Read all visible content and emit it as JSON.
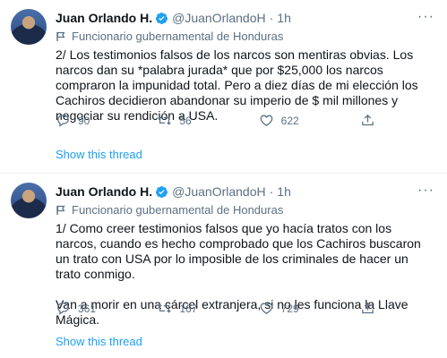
{
  "tweets": [
    {
      "name": "Juan Orlando H.",
      "handle": "@JuanOrlandoH",
      "dot": "·",
      "time": "1h",
      "label": "Funcionario gubernamental de Honduras",
      "paragraphs": [
        "2/ Los testimonios falsos de los narcos son mentiras obvias. Los narcos dan su *palabra jurada* que por $25,000 los narcos compraron la impunidad total. Pero a diez días de mi elección los Cachiros decidieron abandonar su imperio de $ mil millones y negociar su rendición a USA."
      ],
      "replies": "90",
      "retweets": "56",
      "likes": "622",
      "show_thread": "Show this thread"
    },
    {
      "name": "Juan Orlando H.",
      "handle": "@JuanOrlandoH",
      "dot": "·",
      "time": "1h",
      "label": "Funcionario gubernamental de Honduras",
      "paragraphs": [
        "1/ Como creer testimonios falsos que yo hacía tratos con los narcos, cuando es hecho comprobado que los Cachiros buscaron un trato con USA por lo imposible de los criminales de hacer un trato conmigo.",
        "Van a morir en una cárcel extranjera, si no les funciona la Llave Mágica."
      ],
      "replies": "361",
      "retweets": "167",
      "likes": "729",
      "show_thread": "Show this thread"
    }
  ],
  "colors": {
    "accent": "#1da1f2",
    "muted": "#5b7083",
    "text": "#0f1419"
  },
  "icons": [
    "verified-badge-icon",
    "government-flag-icon",
    "reply-icon",
    "retweet-icon",
    "like-icon",
    "share-icon",
    "more-icon"
  ]
}
